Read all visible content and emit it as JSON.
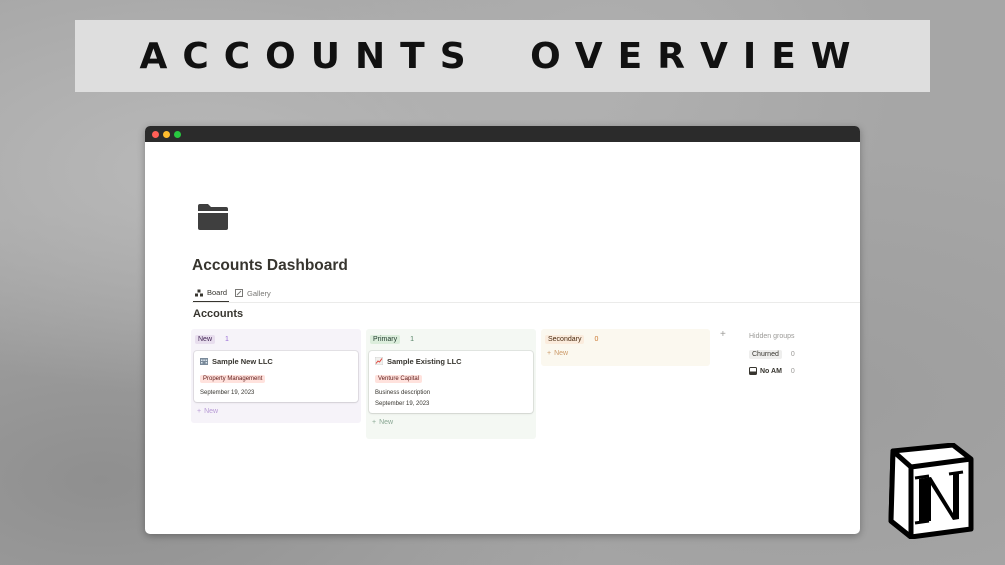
{
  "banner": {
    "title": "ACCOUNTS OVERVIEW"
  },
  "page": {
    "title": "Accounts Dashboard",
    "icon": "folder-icon"
  },
  "tabs": [
    {
      "label": "Board",
      "icon": "board-icon",
      "active": true
    },
    {
      "label": "Gallery",
      "icon": "gallery-icon",
      "active": false
    }
  ],
  "database": {
    "title": "Accounts"
  },
  "columns": [
    {
      "label": "New",
      "count": "1",
      "cards": [
        {
          "title": "Sample New LLC",
          "icon": "building-icon",
          "tag": "Property Management",
          "date": "September 19, 2023"
        }
      ],
      "add_label": "New"
    },
    {
      "label": "Primary",
      "count": "1",
      "cards": [
        {
          "title": "Sample Existing LLC",
          "icon": "chart-icon",
          "tag": "Venture Capital",
          "description": "Business description",
          "date": "September 19, 2023"
        }
      ],
      "add_label": "New"
    },
    {
      "label": "Secondary",
      "count": "0",
      "add_label": "New"
    }
  ],
  "hidden_groups": {
    "label": "Hidden groups",
    "items": [
      {
        "label": "Churned",
        "count": "0"
      },
      {
        "label": "No AM",
        "count": "0",
        "icon": "inbox-icon"
      }
    ]
  },
  "colors": {
    "accent": "#37352f",
    "new": "#e8deee",
    "primary": "#dbeddb",
    "secondary": "#fbecdd"
  },
  "logo": "notion-logo"
}
